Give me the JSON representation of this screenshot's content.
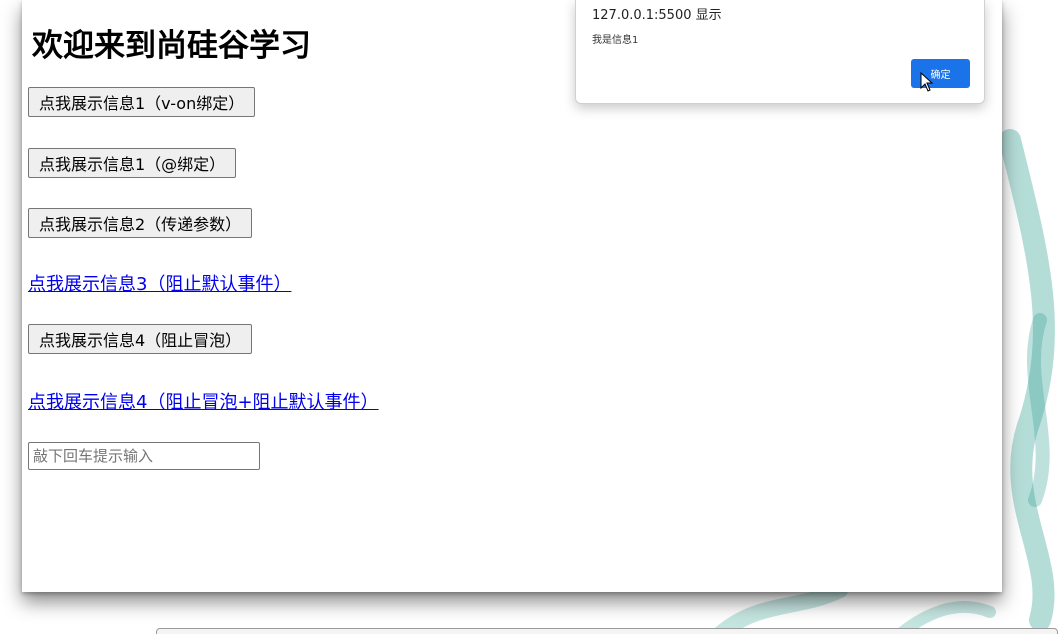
{
  "page": {
    "title": "欢迎来到尚硅谷学习"
  },
  "buttons": {
    "show_info1_von": "点我展示信息1（v-on绑定）",
    "show_info1_at": "点我展示信息1（@绑定）",
    "show_info2_params": "点我展示信息2（传递参数）",
    "show_info4_stop": "点我展示信息4（阻止冒泡）"
  },
  "links": {
    "show_info3_prevent": "点我展示信息3（阻止默认事件）",
    "show_info4_stop_prevent": "点我展示信息4（阻止冒泡+阻止默认事件）"
  },
  "input": {
    "placeholder": "敲下回车提示输入",
    "value": ""
  },
  "alert": {
    "origin": "127.0.0.1:5500 显示",
    "message": "我是信息1",
    "ok_label": "确定"
  },
  "colors": {
    "link": "#0000ee",
    "ok_button": "#1a73e8",
    "deco_teal": "#2a9d8f"
  },
  "icons": {
    "cursor": "mouse-pointer-icon"
  }
}
